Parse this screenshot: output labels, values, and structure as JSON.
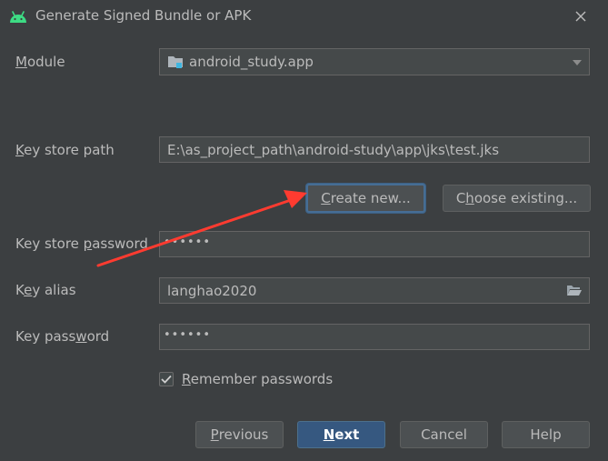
{
  "window": {
    "title": "Generate Signed Bundle or APK",
    "app_icon": "android-icon",
    "close_icon": "close-icon"
  },
  "module": {
    "label_u": "M",
    "label_rest": "odule",
    "value": "android_study.app",
    "icon": "folder-module-icon",
    "dropdown_icon": "chevron-down-icon"
  },
  "key_store_path": {
    "label_u": "K",
    "label_rest": "ey store path",
    "value": "E:\\as_project_path\\android-study\\app\\jks\\test.jks"
  },
  "buttons": {
    "create_u": "C",
    "create_rest": "reate new...",
    "choose_pre": "C",
    "choose_u": "h",
    "choose_rest": "oose existing..."
  },
  "key_store_password": {
    "label_pre": "Key store ",
    "label_u": "p",
    "label_rest": "assword",
    "value": "••••••"
  },
  "key_alias": {
    "label_pre": "K",
    "label_u": "e",
    "label_rest": "y alias",
    "value": "langhao2020",
    "browse_icon": "folder-open-icon"
  },
  "key_password": {
    "label_pre": "Key pass",
    "label_u": "w",
    "label_rest": "ord",
    "value": "••••••"
  },
  "remember": {
    "checked": true,
    "label_u": "R",
    "label_rest": "emember passwords"
  },
  "footer": {
    "previous_u": "P",
    "previous_rest": "revious",
    "next_u": "N",
    "next_rest": "ext",
    "cancel": "Cancel",
    "help": "Help"
  },
  "colors": {
    "background": "#3c3f41",
    "field": "#45494a",
    "primary_button": "#365880",
    "annotation_arrow": "#ff3b30",
    "android_green": "#3ddc84"
  }
}
